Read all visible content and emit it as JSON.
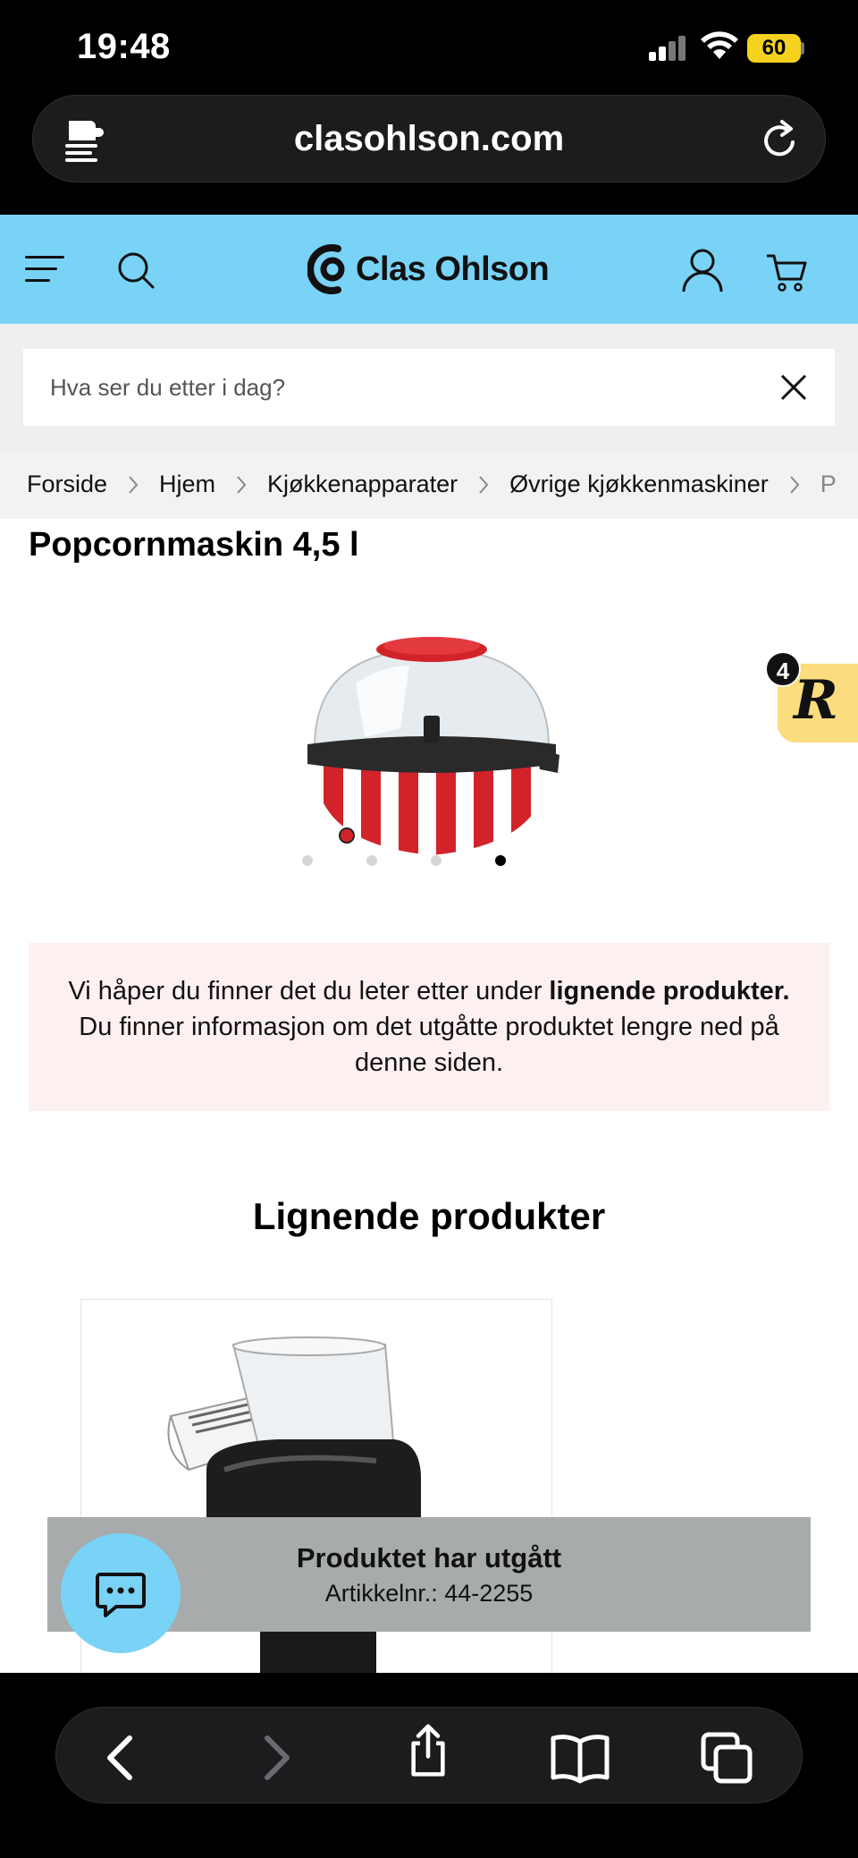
{
  "status_bar": {
    "time": "19:48",
    "battery": "60"
  },
  "browser": {
    "url": "clasohlson.com"
  },
  "header": {
    "brand": "Clas Ohlson"
  },
  "search": {
    "placeholder": "Hva ser du etter i dag?"
  },
  "breadcrumb": {
    "items": [
      "Forside",
      "Hjem",
      "Kjøkkenapparater",
      "Øvrige kjøkkenmaskiner",
      "P"
    ]
  },
  "product": {
    "title": "Popcornmaskin 4,5 l",
    "image_count": 4,
    "active_image": 4
  },
  "rewards_badge": {
    "count": "4",
    "letter": "R"
  },
  "info": {
    "text_1": "Vi håper du finner det du leter etter under ",
    "text_bold": "lignende produkter.",
    "text_2": " Du finner informasjon om det utgåtte produktet lengre ned på denne siden."
  },
  "similar": {
    "title": "Lignende produkter"
  },
  "discontinued": {
    "title": "Produktet har utgått",
    "article": "Artikkelnr.:  44-2255"
  },
  "colors": {
    "header_bg": "#79d3f6",
    "info_bg": "#fdf0f1",
    "badge_bg": "#fbdc7e",
    "banner_bg": "#a7abac"
  }
}
